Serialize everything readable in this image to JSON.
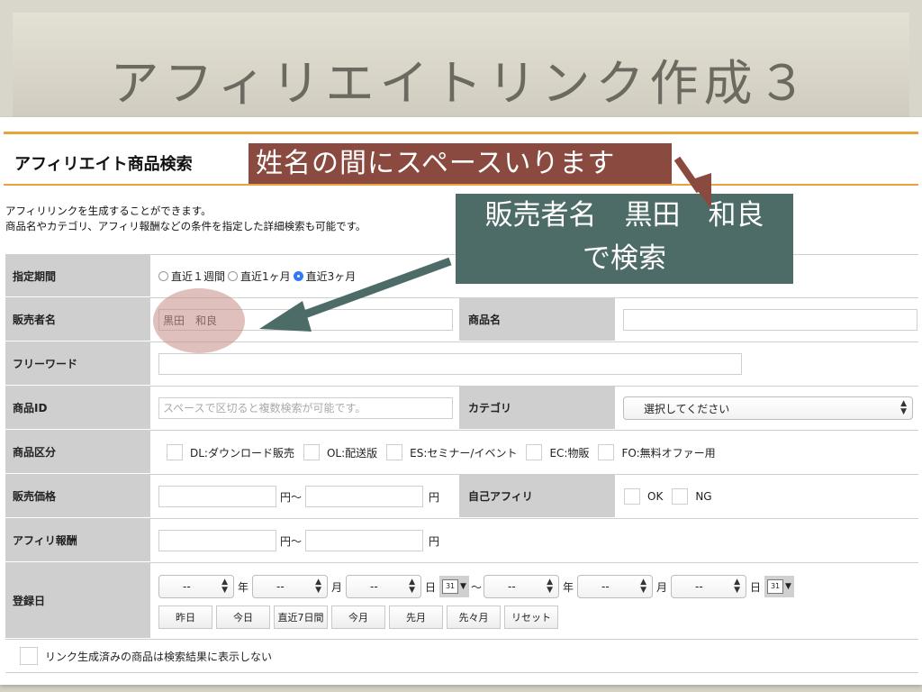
{
  "slide": {
    "title": "アフィリエイトリンク作成３"
  },
  "panel": {
    "heading": "アフィリエイト商品検索",
    "intro_line1": "アフィリリンクを生成することができます。",
    "intro_line2": "商品名やカテゴリ、アフィリ報酬などの条件を指定した詳細検索も可能です。"
  },
  "form": {
    "period": {
      "label": "指定期間",
      "options": [
        "直近１週間",
        "直近1ヶ月",
        "直近3ヶ月"
      ],
      "selected": "直近3ヶ月"
    },
    "seller": {
      "label": "販売者名",
      "value": "黒田　和良"
    },
    "product_name": {
      "label": "商品名",
      "value": ""
    },
    "free_word": {
      "label": "フリーワード",
      "value": ""
    },
    "product_id": {
      "label": "商品ID",
      "placeholder": "スペースで区切ると複数検索が可能です。"
    },
    "category": {
      "label": "カテゴリ",
      "selected": "選択してください"
    },
    "product_type": {
      "label": "商品区分",
      "options": [
        "DL:ダウンロード販売",
        "OL:配送版",
        "ES:セミナー/イベント",
        "EC:物販",
        "FO:無料オファー用"
      ]
    },
    "price": {
      "label": "販売価格",
      "unit_from": "円〜",
      "unit_to": "円"
    },
    "self_affiliate": {
      "label": "自己アフィリ",
      "options": [
        "OK",
        "NG"
      ]
    },
    "reward": {
      "label": "アフィリ報酬",
      "unit_from": "円〜",
      "unit_to": "円"
    },
    "registered": {
      "label": "登録日",
      "placeholder": "--",
      "year": "年",
      "month": "月",
      "day": "日",
      "tilde": "〜",
      "calendar": "31",
      "quick_buttons": [
        "昨日",
        "今日",
        "直近7日間",
        "今月",
        "先月",
        "先々月",
        "リセット"
      ]
    },
    "hide_generated": {
      "label": "リンク生成済みの商品は検索結果に表示しない"
    }
  },
  "annotations": {
    "note1": "姓名の間にスペースいります",
    "note2_line1": "販売者名　黒田　和良",
    "note2_line2": "で検索"
  },
  "colors": {
    "accent": "#e8a33c",
    "label_bg": "#cfcfcf",
    "note_red": "#8a4a40",
    "note_teal": "#4d6c67",
    "radio_on": "#3478f6"
  }
}
